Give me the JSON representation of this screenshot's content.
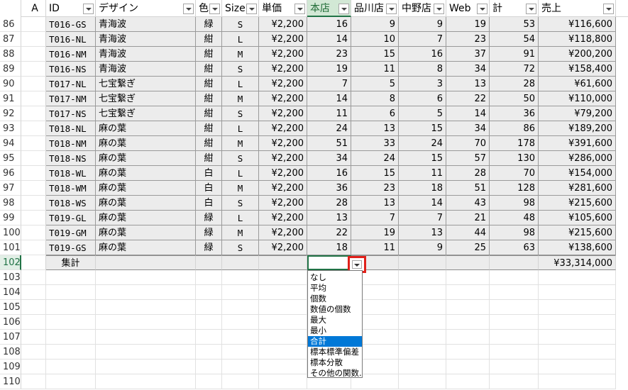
{
  "columns": {
    "A": "A",
    "id": "ID",
    "design": "デザイン",
    "color": "色",
    "size": "Size",
    "price": "単価",
    "honten": "本店",
    "shinagawa": "品川店",
    "nakano": "中野店",
    "web": "Web",
    "total": "計",
    "sales": "売上"
  },
  "rows": [
    {
      "num": "86",
      "id": "T016-GS",
      "design": "青海波",
      "color": "緑",
      "size": "S",
      "price": "¥2,200",
      "honten": "16",
      "shinagawa": "9",
      "nakano": "9",
      "web": "19",
      "total": "53",
      "sales": "¥116,600"
    },
    {
      "num": "87",
      "id": "T016-NL",
      "design": "青海波",
      "color": "紺",
      "size": "L",
      "price": "¥2,200",
      "honten": "14",
      "shinagawa": "10",
      "nakano": "7",
      "web": "23",
      "total": "54",
      "sales": "¥118,800"
    },
    {
      "num": "88",
      "id": "T016-NM",
      "design": "青海波",
      "color": "紺",
      "size": "M",
      "price": "¥2,200",
      "honten": "23",
      "shinagawa": "15",
      "nakano": "16",
      "web": "37",
      "total": "91",
      "sales": "¥200,200"
    },
    {
      "num": "89",
      "id": "T016-NS",
      "design": "青海波",
      "color": "紺",
      "size": "S",
      "price": "¥2,200",
      "honten": "19",
      "shinagawa": "11",
      "nakano": "8",
      "web": "34",
      "total": "72",
      "sales": "¥158,400"
    },
    {
      "num": "90",
      "id": "T017-NL",
      "design": "七宝繋ぎ",
      "color": "紺",
      "size": "L",
      "price": "¥2,200",
      "honten": "7",
      "shinagawa": "5",
      "nakano": "3",
      "web": "13",
      "total": "28",
      "sales": "¥61,600"
    },
    {
      "num": "91",
      "id": "T017-NM",
      "design": "七宝繋ぎ",
      "color": "紺",
      "size": "M",
      "price": "¥2,200",
      "honten": "14",
      "shinagawa": "8",
      "nakano": "6",
      "web": "22",
      "total": "50",
      "sales": "¥110,000"
    },
    {
      "num": "92",
      "id": "T017-NS",
      "design": "七宝繋ぎ",
      "color": "紺",
      "size": "S",
      "price": "¥2,200",
      "honten": "11",
      "shinagawa": "6",
      "nakano": "5",
      "web": "14",
      "total": "36",
      "sales": "¥79,200"
    },
    {
      "num": "93",
      "id": "T018-NL",
      "design": "麻の葉",
      "color": "紺",
      "size": "L",
      "price": "¥2,200",
      "honten": "24",
      "shinagawa": "13",
      "nakano": "15",
      "web": "34",
      "total": "86",
      "sales": "¥189,200"
    },
    {
      "num": "94",
      "id": "T018-NM",
      "design": "麻の葉",
      "color": "紺",
      "size": "M",
      "price": "¥2,200",
      "honten": "51",
      "shinagawa": "33",
      "nakano": "24",
      "web": "70",
      "total": "178",
      "sales": "¥391,600"
    },
    {
      "num": "95",
      "id": "T018-NS",
      "design": "麻の葉",
      "color": "紺",
      "size": "S",
      "price": "¥2,200",
      "honten": "34",
      "shinagawa": "24",
      "nakano": "15",
      "web": "57",
      "total": "130",
      "sales": "¥286,000"
    },
    {
      "num": "96",
      "id": "T018-WL",
      "design": "麻の葉",
      "color": "白",
      "size": "L",
      "price": "¥2,200",
      "honten": "16",
      "shinagawa": "15",
      "nakano": "11",
      "web": "28",
      "total": "70",
      "sales": "¥154,000"
    },
    {
      "num": "97",
      "id": "T018-WM",
      "design": "麻の葉",
      "color": "白",
      "size": "M",
      "price": "¥2,200",
      "honten": "36",
      "shinagawa": "23",
      "nakano": "18",
      "web": "51",
      "total": "128",
      "sales": "¥281,600"
    },
    {
      "num": "98",
      "id": "T018-WS",
      "design": "麻の葉",
      "color": "白",
      "size": "S",
      "price": "¥2,200",
      "honten": "28",
      "shinagawa": "13",
      "nakano": "14",
      "web": "43",
      "total": "98",
      "sales": "¥215,600"
    },
    {
      "num": "99",
      "id": "T019-GL",
      "design": "麻の葉",
      "color": "緑",
      "size": "L",
      "price": "¥2,200",
      "honten": "13",
      "shinagawa": "7",
      "nakano": "7",
      "web": "21",
      "total": "48",
      "sales": "¥105,600"
    },
    {
      "num": "100",
      "id": "T019-GM",
      "design": "麻の葉",
      "color": "緑",
      "size": "M",
      "price": "¥2,200",
      "honten": "22",
      "shinagawa": "19",
      "nakano": "13",
      "web": "44",
      "total": "98",
      "sales": "¥215,600"
    },
    {
      "num": "101",
      "id": "T019-GS",
      "design": "麻の葉",
      "color": "緑",
      "size": "S",
      "price": "¥2,200",
      "honten": "18",
      "shinagawa": "11",
      "nakano": "9",
      "web": "25",
      "total": "63",
      "sales": "¥138,600"
    }
  ],
  "total_row": {
    "num": "102",
    "label": "集計",
    "sales": "¥33,314,000"
  },
  "empty_rows": [
    "103",
    "104",
    "105",
    "106",
    "107",
    "108",
    "109",
    "110"
  ],
  "menu": {
    "items": [
      "なし",
      "平均",
      "個数",
      "数値の個数",
      "最大",
      "最小",
      "合計",
      "標本標準偏差",
      "標本分散",
      "その他の関数..."
    ],
    "selected": "合計"
  },
  "colors": {
    "accent": "#217346",
    "highlight": "#e0201a",
    "menu_selection": "#0078d7"
  }
}
